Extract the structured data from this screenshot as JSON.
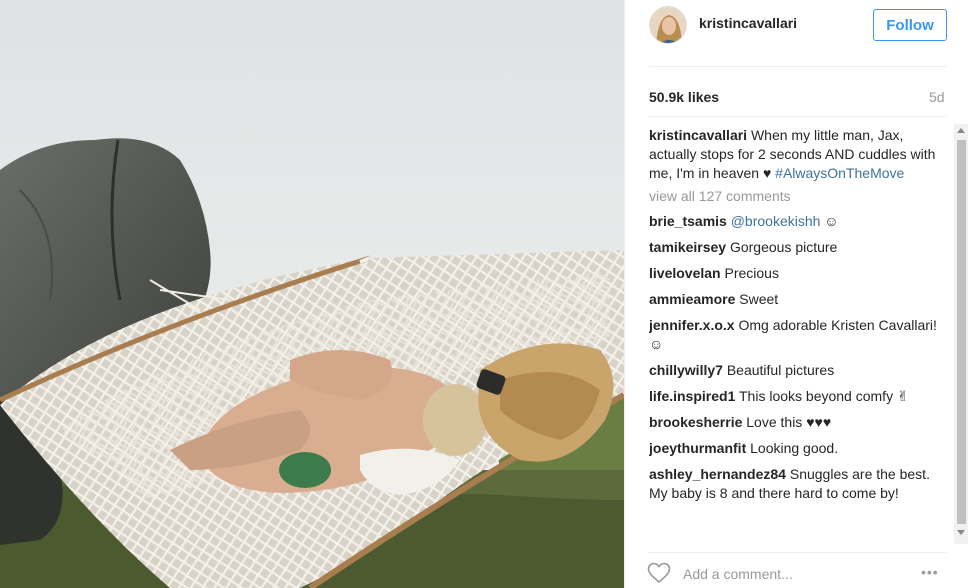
{
  "post": {
    "username": "kristincavallari",
    "follow_label": "Follow",
    "likes": "50.9k likes",
    "time_ago": "5d",
    "caption_user": "kristincavallari",
    "caption_text": " When my little man, Jax, actually stops for 2 seconds AND cuddles with me, I'm in heaven ♥",
    "caption_tag": "#AlwaysOnTheMove",
    "view_all": "view all 127 comments"
  },
  "comments": [
    {
      "user": "brie_tsamis",
      "mention": "@brookekishh",
      "text": " ☺"
    },
    {
      "user": "tamikeirsey",
      "mention": "",
      "text": " Gorgeous picture"
    },
    {
      "user": "livelovelan",
      "mention": "",
      "text": " Precious"
    },
    {
      "user": "ammieamore",
      "mention": "",
      "text": " Sweet"
    },
    {
      "user": "jennifer.x.o.x",
      "mention": "",
      "text": " Omg adorable Kristen Cavallari! ☺"
    },
    {
      "user": "chillywilly7",
      "mention": "",
      "text": " Beautiful pictures"
    },
    {
      "user": "life.inspired1",
      "mention": "",
      "text": " This looks beyond comfy ✌"
    },
    {
      "user": "brookesherrie",
      "mention": "",
      "text": " Love this ♥♥♥"
    },
    {
      "user": "joeythurmanfit",
      "mention": "",
      "text": " Looking good."
    },
    {
      "user": "ashley_hernandez84",
      "mention": "",
      "text": " Snuggles are the best. My baby is 8 and there hard to come by!"
    }
  ],
  "footer": {
    "add_comment_placeholder": "Add a comment...",
    "more_label": "•••"
  },
  "colors": {
    "accent": "#3897f0",
    "hashtag": "#3f729b",
    "muted": "#999999"
  },
  "icons": {
    "like": "heart-icon",
    "more": "more-options-icon"
  }
}
